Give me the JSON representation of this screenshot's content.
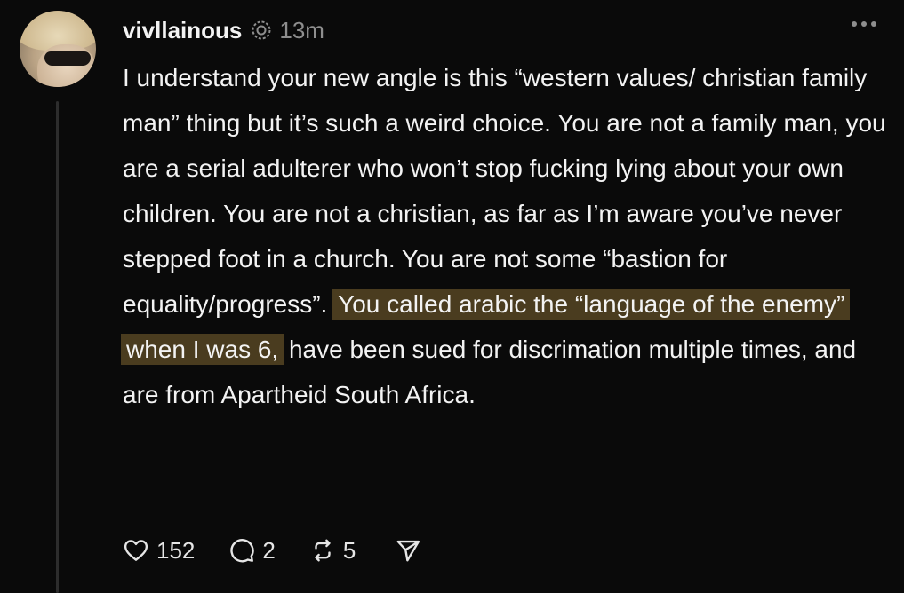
{
  "post": {
    "author": "vivllainous",
    "time": "13m",
    "text_before": "I understand your new angle is this “western values/ christian family man” thing but it’s such a weird choice. You are not a family man, you are a serial adulterer who won’t stop fucking lying about your own children. You are not a christian, as far as I’m aware you’ve never stepped foot in a church. You are not some “bastion for equality/progress”. ",
    "text_highlight": "You called arabic the “language of the enemy” when I was 6,",
    "text_after": " have been sued for discrimation multiple times, and are from Apartheid South Africa.",
    "highlight_color": "#4a3c1f"
  },
  "actions": {
    "likes": "152",
    "replies": "2",
    "reposts": "5"
  },
  "icons": {
    "meta": "circle-logo-icon",
    "more": "more-icon",
    "like": "heart-icon",
    "reply": "comment-icon",
    "repost": "repost-icon",
    "share": "send-icon"
  }
}
